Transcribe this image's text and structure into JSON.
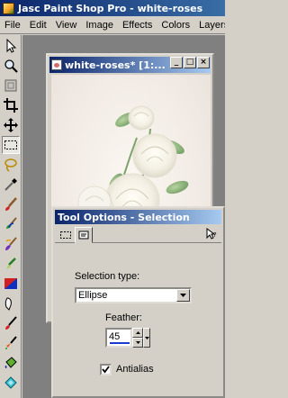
{
  "app": {
    "title": "Jasc Paint Shop Pro - white-roses"
  },
  "menu": {
    "items": [
      "File",
      "Edit",
      "View",
      "Image",
      "Effects",
      "Colors",
      "Layers"
    ]
  },
  "toolbar": {
    "tools": [
      "arrow-icon",
      "zoom-icon",
      "deform-icon",
      "crop-icon",
      "mover-icon",
      "selection-icon",
      "freehand-icon",
      "dropper-icon",
      "paintbrush-icon",
      "clone-brush-icon",
      "color-replacer-icon",
      "retouch-icon",
      "scratch-remover-icon",
      "eraser-icon",
      "picture-tube-icon",
      "airbrush-icon",
      "flood-fill-icon",
      "text-icon"
    ],
    "active": "selection-icon"
  },
  "image_window": {
    "title": "white-roses* [1:..."
  },
  "tool_options": {
    "title": "Tool Options - Selection",
    "selection_type_label": "Selection type:",
    "selection_type_value": "Ellipse",
    "feather_label": "Feather:",
    "feather_value": "45",
    "antialias_label": "Antialias",
    "antialias_checked": true
  },
  "colors": {
    "titlebar_start": "#0a246a",
    "titlebar_end": "#a6caf0",
    "face": "#d4d0c8",
    "workspace": "#808080"
  }
}
